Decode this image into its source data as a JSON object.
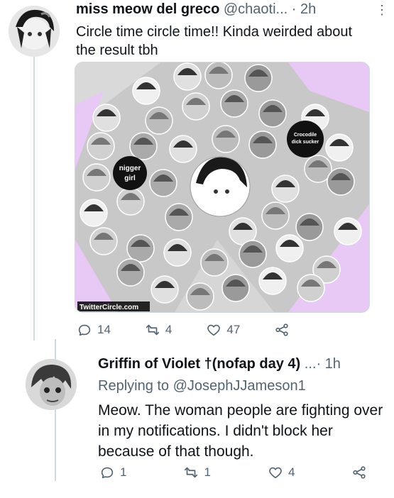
{
  "tweet1": {
    "display_name": "miss meow del greco",
    "handle": "@chaoti...",
    "time": "· 2h",
    "more_icon": "more-icon",
    "text": "Circle time circle time!! Kinda weirded about the result tbh",
    "image": {
      "labels": [
        "Crocodile dick sucker",
        "nigger girl"
      ],
      "watermark": "TwitterCircle.com"
    },
    "actions": {
      "replies": "14",
      "retweets": "4",
      "likes": "47"
    }
  },
  "tweet2": {
    "display_name": "Griffin of Violet †(nofap day 4)",
    "ellipsis": "...",
    "time": "· 1h",
    "replying_to": "Replying to @JosephJJameson1",
    "text": "Meow. The woman people are fighting over in my notifications. I didn't block her because of that though.",
    "actions": {
      "replies": "1",
      "retweets": "1",
      "likes": "4"
    }
  },
  "colors": {
    "muted": "#536471",
    "line": "#cfd9de",
    "circle_bg": "#c9c9c9",
    "accent_pink": "#e8c8f4"
  }
}
